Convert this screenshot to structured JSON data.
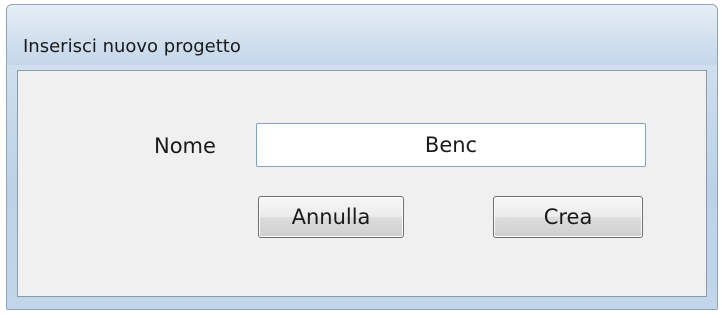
{
  "window": {
    "title": "Inserisci nuovo progetto"
  },
  "form": {
    "name_label": "Nome",
    "name_value": "Benc"
  },
  "buttons": {
    "cancel_label": "Annulla",
    "create_label": "Crea"
  }
}
